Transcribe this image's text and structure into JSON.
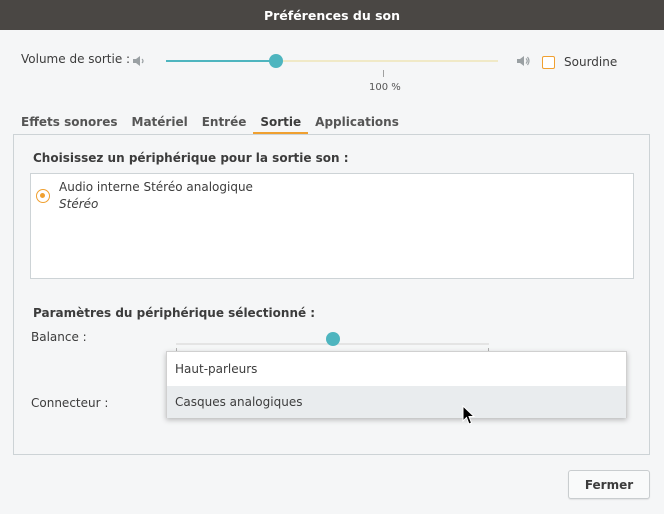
{
  "window": {
    "title": "Préférences du son"
  },
  "output": {
    "volume_label": "Volume de sortie :",
    "volume_value": "100 %",
    "volume_fraction": 0.33,
    "mute_label": "Sourdine",
    "mute_checked": false
  },
  "tabs": [
    {
      "label": "Effets sonores",
      "active": false
    },
    {
      "label": "Matériel",
      "active": false
    },
    {
      "label": "Entrée",
      "active": false
    },
    {
      "label": "Sortie",
      "active": true
    },
    {
      "label": "Applications",
      "active": false
    }
  ],
  "sortie": {
    "choose_label": "Choisissez un périphérique pour la sortie son :",
    "devices": [
      {
        "name": "Audio interne Stéréo analogique",
        "profile": "Stéréo",
        "selected": true
      }
    ],
    "params_label": "Paramètres du périphérique sélectionné :",
    "balance_label": "Balance :",
    "balance_fraction": 0.5,
    "connector_label": "Connecteur :",
    "connector_options": [
      "Haut-parleurs",
      "Casques analogiques"
    ],
    "connector_hover": "Casques analogiques"
  },
  "footer": {
    "close_label": "Fermer"
  },
  "icons": {
    "speaker_low": "speaker-low-icon",
    "speaker_high": "speaker-high-icon",
    "cursor": "mouse-cursor-icon"
  },
  "colors": {
    "accent": "#f0a030",
    "slider": "#4eb5bf",
    "titlebar": "#4a4744"
  }
}
